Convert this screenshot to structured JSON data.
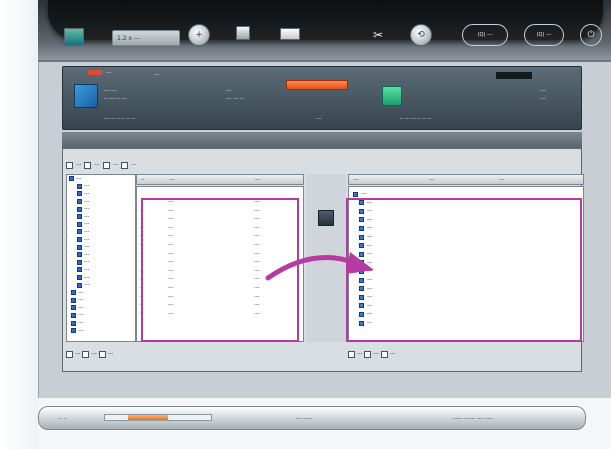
{
  "header": {
    "field_text": "1.2 x ---",
    "right_labels": [
      "(Q) ---",
      "(Q) ---"
    ]
  },
  "status": {
    "left_code": "---",
    "left_sub": "---",
    "left_lines": [
      "--- ---",
      "-- --- -- ---"
    ],
    "mid_labels": [
      "---",
      "---",
      "--- --- --"
    ],
    "bottom_left": "--- -- -- -- -- --",
    "bottom_mid": "---",
    "bottom_right": "-- -- --- -- -- --",
    "right_labels": [
      "---",
      "---"
    ]
  },
  "main": {
    "toolbar": [
      "---",
      "---",
      "---",
      "---"
    ],
    "tree_root": "---",
    "tree_items": [
      "---",
      "---",
      "---",
      "---",
      "---",
      "---",
      "---",
      "---",
      "---",
      "---",
      "---",
      "---",
      "---",
      "---",
      "---",
      "---",
      "---",
      "---",
      "---",
      "---"
    ],
    "left_columns": [
      "--",
      "---",
      "---"
    ],
    "left_rows": [
      [
        "--",
        "---",
        "---"
      ],
      [
        "--",
        "---",
        "---"
      ],
      [
        "--",
        "---",
        "---"
      ],
      [
        "--",
        "---",
        "---"
      ],
      [
        "--",
        "---",
        "---"
      ],
      [
        "--",
        "---",
        "---"
      ],
      [
        "--",
        "---",
        "---"
      ],
      [
        "--",
        "---",
        "---"
      ],
      [
        "--",
        "---",
        "---"
      ],
      [
        "--",
        "---",
        "---"
      ],
      [
        "--",
        "---",
        "---"
      ],
      [
        "--",
        "---",
        "---"
      ],
      [
        "--",
        "---",
        "---"
      ],
      [
        "--",
        "---",
        "---"
      ]
    ],
    "right_columns": [
      "---",
      "---",
      "---"
    ],
    "right_rows": [
      "---",
      "---",
      "---",
      "---",
      "---",
      "---",
      "---",
      "---",
      "---",
      "---",
      "---",
      "---",
      "---",
      "---",
      "---",
      "---"
    ],
    "bottom_left": [
      "---",
      "---",
      "---"
    ],
    "bottom_right": [
      "---",
      "---",
      "---"
    ]
  },
  "footer": {
    "left": "-- --",
    "mid": "--- -----",
    "right": "------ ------ ---- ----"
  },
  "colors": {
    "highlight": "#b73aa3",
    "accent_orange": "#e0501c",
    "brand_blue": "#2f6ec8"
  }
}
